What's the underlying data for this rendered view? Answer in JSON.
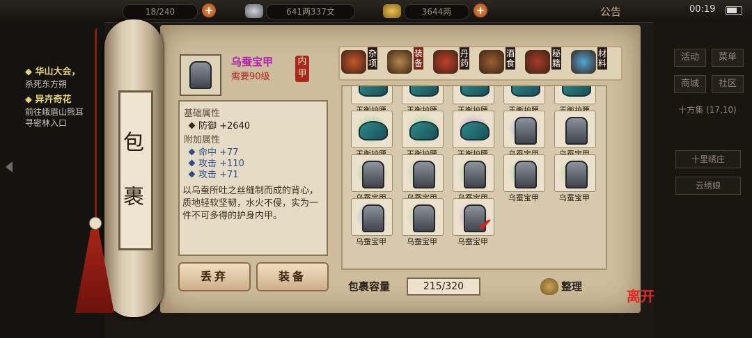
{
  "topbar": {
    "stamina": "18/240",
    "copper": "641两337文",
    "gold": "3644两",
    "notice": "公告",
    "clock": "00:19"
  },
  "quests": [
    {
      "title": "华山大会，",
      "desc": "杀死东方朔"
    },
    {
      "title": "异卉奇花",
      "desc": "前往峨眉山熊耳",
      "desc2": "寻密林入口"
    }
  ],
  "side": {
    "buttons": [
      "活动",
      "菜单",
      "商城",
      "社区"
    ],
    "location": "十方集",
    "coords": "(17,10)",
    "npcs": [
      "十里绣庄",
      "云绣娘"
    ]
  },
  "bag_title": [
    "包",
    "裹"
  ],
  "selected": {
    "name": "乌蚕宝甲",
    "level": "需要90级",
    "slot_badge": "内甲",
    "base_header": "基础属性",
    "base_stats": [
      "防御  +2640"
    ],
    "extra_header": "附加属性",
    "extra_stats": [
      "命中  +77",
      "攻击  +110",
      "攻击  +71"
    ],
    "description": "以乌蚕所吐之丝缝制而成的背心，质地轻软坚韧，水火不侵，实为一件不可多得的护身内甲。"
  },
  "actions": {
    "discard": "丢弃",
    "equip": "装备"
  },
  "tabs": [
    {
      "label": "杂项",
      "color": "#c8552a"
    },
    {
      "label": "装备",
      "color": "#b7864a"
    },
    {
      "label": "丹药",
      "color": "#c7402a"
    },
    {
      "label": "酒食",
      "color": "#9a5f33"
    },
    {
      "label": "秘籍",
      "color": "#a83a28"
    },
    {
      "label": "材料",
      "color": "#4fa7d9"
    }
  ],
  "active_tab": 1,
  "items": [
    {
      "name": "玉衡护腰",
      "type": "belt",
      "glow": "none"
    },
    {
      "name": "玉衡护腰",
      "type": "belt",
      "glow": "none"
    },
    {
      "name": "玉衡护腰",
      "type": "belt",
      "glow": "none"
    },
    {
      "name": "玉衡护腰",
      "type": "belt",
      "glow": "none"
    },
    {
      "name": "玉衡护腰",
      "type": "belt",
      "glow": "none"
    },
    {
      "name": "玉衡护腰",
      "type": "belt",
      "glow": "#8fd38a"
    },
    {
      "name": "玉衡护腰",
      "type": "belt",
      "glow": "#8fd38a"
    },
    {
      "name": "玉衡护腰",
      "type": "belt",
      "glow": "#c98fd6"
    },
    {
      "name": "乌蚕宝甲",
      "type": "armor",
      "glow": "#8fa6e0"
    },
    {
      "name": "乌蚕宝甲",
      "type": "armor",
      "glow": "none"
    },
    {
      "name": "乌蚕宝甲",
      "type": "armor",
      "glow": "#8fd38a"
    },
    {
      "name": "乌蚕宝甲",
      "type": "armor",
      "glow": "#8fd38a"
    },
    {
      "name": "乌蚕宝甲",
      "type": "armor",
      "glow": "#8fd38a"
    },
    {
      "name": "乌蚕宝甲",
      "type": "armor",
      "glow": "#8fd38a"
    },
    {
      "name": "乌蚕宝甲",
      "type": "armor",
      "glow": "#8fd38a"
    },
    {
      "name": "乌蚕宝甲",
      "type": "armor",
      "glow": "#8fa6e0"
    },
    {
      "name": "乌蚕宝甲",
      "type": "armor",
      "glow": "#8fd38a"
    },
    {
      "name": "乌蚕宝甲",
      "type": "armor",
      "glow": "#c98fd6",
      "selected": true
    }
  ],
  "capacity": {
    "label": "包裹容量",
    "value": "215/320"
  },
  "sort_label": "整理",
  "leave_label": "离开"
}
